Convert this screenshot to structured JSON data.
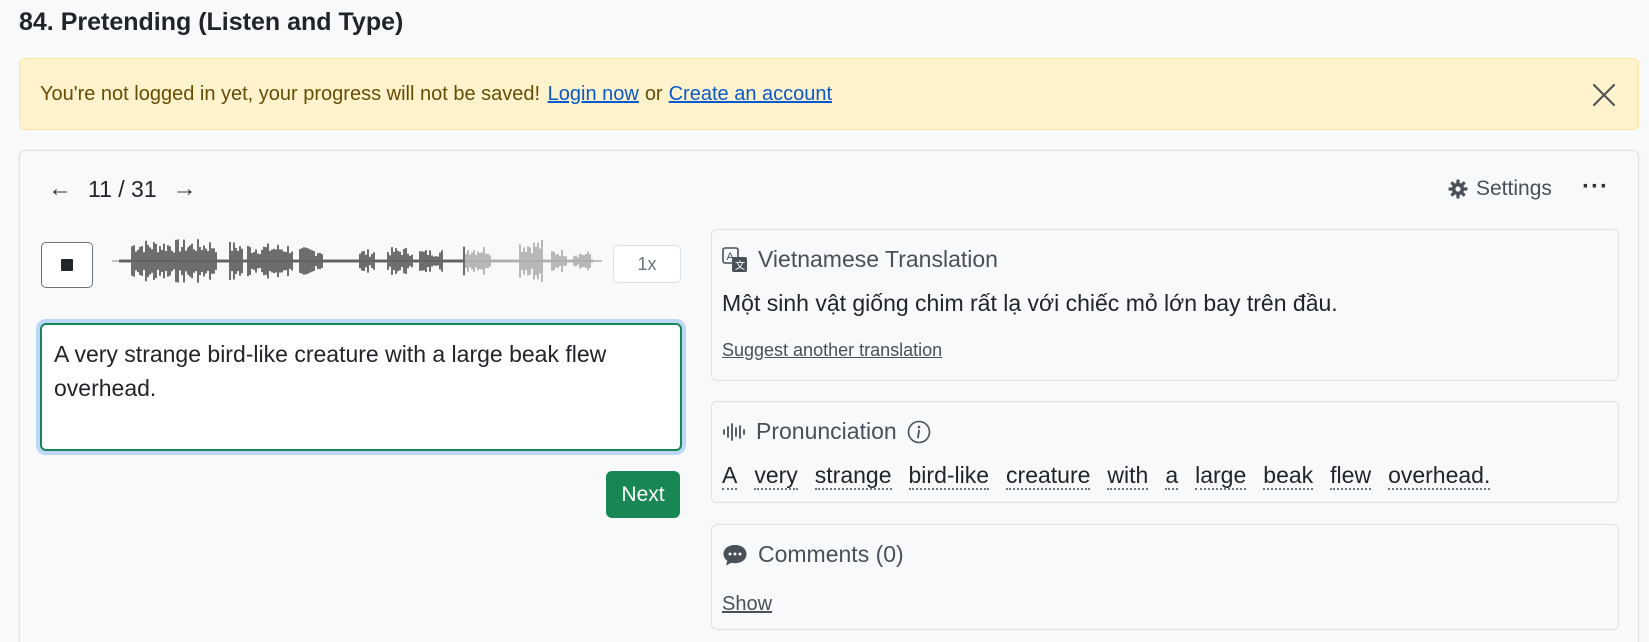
{
  "page": {
    "title": "84. Pretending (Listen and Type)"
  },
  "alert": {
    "message": "You're not logged in yet, your progress will not be saved!",
    "login_link": "Login now",
    "separator": "or",
    "create_link": "Create an account"
  },
  "player": {
    "position": "11 / 31",
    "speed": "1x",
    "progress": 0.72
  },
  "toolbar": {
    "settings_label": "Settings",
    "more_label": "···"
  },
  "answer": {
    "value": "A very strange bird-like creature with a large beak flew overhead."
  },
  "next_button": {
    "label": "Next"
  },
  "translation": {
    "title": "Vietnamese Translation",
    "text": "Một sinh vật giống chim rất lạ với chiếc mỏ lớn bay trên đầu.",
    "suggest_link": "Suggest another translation"
  },
  "pronunciation": {
    "title": "Pronunciation",
    "words": [
      "A",
      "very",
      "strange",
      "bird-like",
      "creature",
      "with",
      "a",
      "large",
      "beak",
      "flew",
      "overhead."
    ]
  },
  "comments": {
    "title": "Comments (0)",
    "show_link": "Show"
  },
  "colors": {
    "accent_green": "#198754",
    "alert_bg": "#fff3cd",
    "link": "#0a58ca"
  }
}
